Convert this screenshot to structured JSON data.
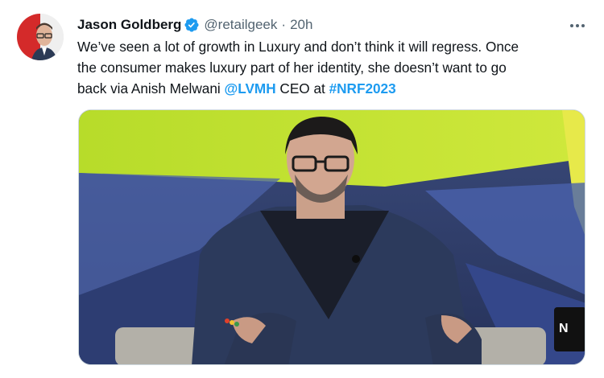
{
  "tweet": {
    "author": {
      "name": "Jason Goldberg",
      "handle": "@retailgeek",
      "verified": true
    },
    "separator": "·",
    "time": "20h",
    "text_lines": [
      "We’ve seen a lot of growth in Luxury and don’t think it will regress. Once",
      "the consumer makes luxury part of her identity, she doesn’t want to go",
      "back via Anish Melwani "
    ],
    "mention": "@LVMH",
    "after_mention": " CEO at ",
    "hashtag": "#NRF2023",
    "media": {
      "description_icon": "photo"
    }
  },
  "colors": {
    "link": "#1d9bf0",
    "verified": "#1d9bf0",
    "secondary_text": "#536471"
  }
}
